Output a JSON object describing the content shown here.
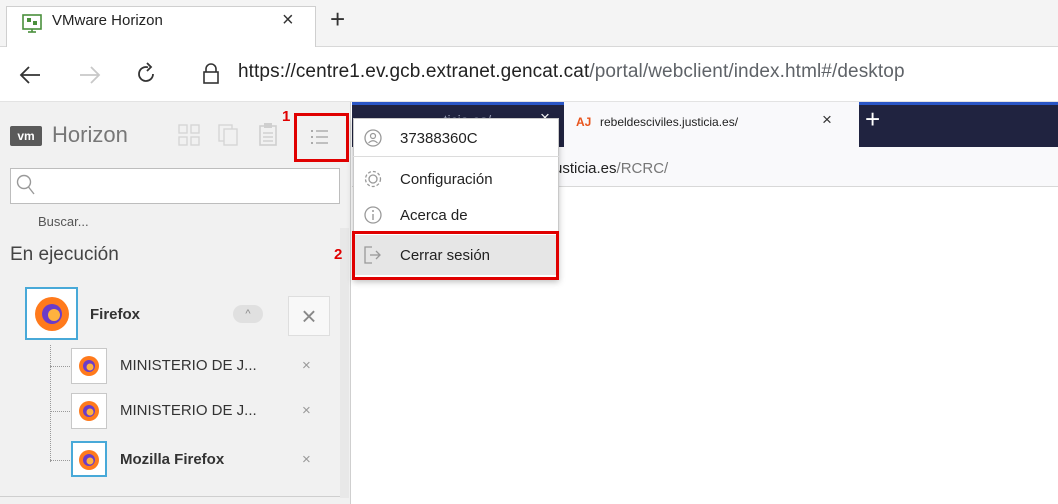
{
  "browser": {
    "tab_title": "VMware Horizon",
    "tab_close": "×",
    "new_tab": "+",
    "url_main": "https://centre1.ev.gcb.extranet.gencat.cat",
    "url_path": "/portal/webclient/index.html#/desktop"
  },
  "horizon": {
    "logo": "vm",
    "brand": "Horizon",
    "search_placeholder": "Buscar...",
    "section_running": "En ejecución",
    "app_name": "Firefox",
    "collapse": "^",
    "close": "×",
    "windows": [
      {
        "label": "MINISTERIO DE J...",
        "close": "×",
        "bold": false
      },
      {
        "label": "MINISTERIO DE J...",
        "close": "×",
        "bold": false
      },
      {
        "label": "Mozilla Firefox",
        "close": "×",
        "bold": true
      }
    ]
  },
  "inner_browser": {
    "partial_tab": "...ticia.es/...",
    "tab_title": "rebeldesciviles.justicia.es/",
    "tab_icon": "AJ",
    "tab_close": "×",
    "new_tab": "+",
    "url_main": "usticia.es",
    "url_path": "/RCRC/"
  },
  "menu": {
    "user": "37388360C",
    "settings": "Configuración",
    "about": "Acerca de",
    "logout": "Cerrar sesión"
  },
  "annotations": {
    "step1": "1",
    "step2": "2"
  },
  "colors": {
    "highlight": "#e00000",
    "accent": "#48a9d8",
    "inner_tabbar": "#202340"
  }
}
